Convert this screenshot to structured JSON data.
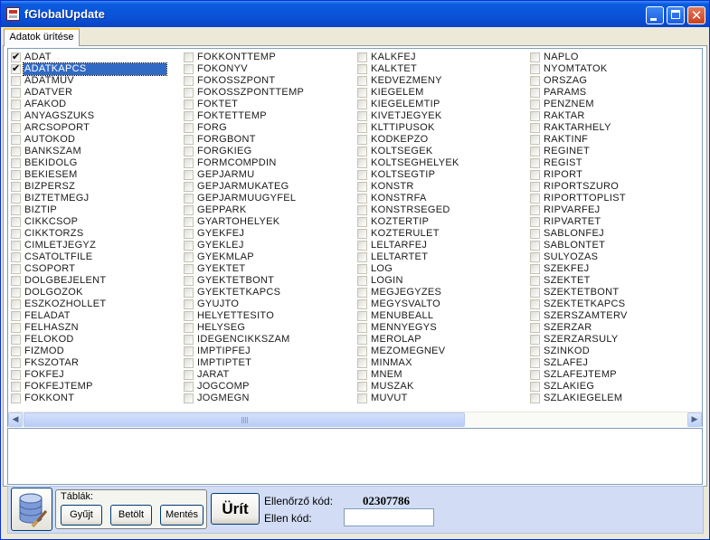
{
  "window": {
    "title": "fGlobalUpdate"
  },
  "tabs": [
    {
      "label": "Adatok ürítése"
    }
  ],
  "columns": [
    [
      {
        "label": "ADAT",
        "checked": true,
        "selected": false
      },
      {
        "label": "ADATKAPCS",
        "checked": true,
        "selected": true
      },
      {
        "label": "ADATMUV",
        "checked": false,
        "selected": false
      },
      {
        "label": "ADATVER",
        "checked": false,
        "selected": false
      },
      {
        "label": "AFAKOD",
        "checked": false,
        "selected": false
      },
      {
        "label": "ANYAGSZUKS",
        "checked": false,
        "selected": false
      },
      {
        "label": "ARCSOPORT",
        "checked": false,
        "selected": false
      },
      {
        "label": "AUTOKOD",
        "checked": false,
        "selected": false
      },
      {
        "label": "BANKSZAM",
        "checked": false,
        "selected": false
      },
      {
        "label": "BEKIDOLG",
        "checked": false,
        "selected": false
      },
      {
        "label": "BEKIESEM",
        "checked": false,
        "selected": false
      },
      {
        "label": "BIZPERSZ",
        "checked": false,
        "selected": false
      },
      {
        "label": "BIZTETMEGJ",
        "checked": false,
        "selected": false
      },
      {
        "label": "BIZTIP",
        "checked": false,
        "selected": false
      },
      {
        "label": "CIKKCSOP",
        "checked": false,
        "selected": false
      },
      {
        "label": "CIKKTORZS",
        "checked": false,
        "selected": false
      },
      {
        "label": "CIMLETJEGYZ",
        "checked": false,
        "selected": false
      },
      {
        "label": "CSATOLTFILE",
        "checked": false,
        "selected": false
      },
      {
        "label": "CSOPORT",
        "checked": false,
        "selected": false
      },
      {
        "label": "DOLGBEJELENT",
        "checked": false,
        "selected": false
      },
      {
        "label": "DOLGOZOK",
        "checked": false,
        "selected": false
      },
      {
        "label": "ESZKOZHOLLET",
        "checked": false,
        "selected": false
      },
      {
        "label": "FELADAT",
        "checked": false,
        "selected": false
      },
      {
        "label": "FELHASZN",
        "checked": false,
        "selected": false
      },
      {
        "label": "FELOKOD",
        "checked": false,
        "selected": false
      },
      {
        "label": "FIZMOD",
        "checked": false,
        "selected": false
      },
      {
        "label": "FKSZOTAR",
        "checked": false,
        "selected": false
      },
      {
        "label": "FOKFEJ",
        "checked": false,
        "selected": false
      },
      {
        "label": "FOKFEJTEMP",
        "checked": false,
        "selected": false
      },
      {
        "label": "FOKKONT",
        "checked": false,
        "selected": false
      }
    ],
    [
      {
        "label": "FOKKONTTEMP",
        "checked": false,
        "selected": false
      },
      {
        "label": "FOKONYV",
        "checked": false,
        "selected": false
      },
      {
        "label": "FOKOSSZPONT",
        "checked": false,
        "selected": false
      },
      {
        "label": "FOKOSSZPONTTEMP",
        "checked": false,
        "selected": false
      },
      {
        "label": "FOKTET",
        "checked": false,
        "selected": false
      },
      {
        "label": "FOKTETTEMP",
        "checked": false,
        "selected": false
      },
      {
        "label": "FORG",
        "checked": false,
        "selected": false
      },
      {
        "label": "FORGBONT",
        "checked": false,
        "selected": false
      },
      {
        "label": "FORGKIEG",
        "checked": false,
        "selected": false
      },
      {
        "label": "FORMCOMPDIN",
        "checked": false,
        "selected": false
      },
      {
        "label": "GEPJARMU",
        "checked": false,
        "selected": false
      },
      {
        "label": "GEPJARMUKATEG",
        "checked": false,
        "selected": false
      },
      {
        "label": "GEPJARMUUGYFEL",
        "checked": false,
        "selected": false
      },
      {
        "label": "GEPPARK",
        "checked": false,
        "selected": false
      },
      {
        "label": "GYARTOHELYEK",
        "checked": false,
        "selected": false
      },
      {
        "label": "GYEKFEJ",
        "checked": false,
        "selected": false
      },
      {
        "label": "GYEKLEJ",
        "checked": false,
        "selected": false
      },
      {
        "label": "GYEKMLAP",
        "checked": false,
        "selected": false
      },
      {
        "label": "GYEKTET",
        "checked": false,
        "selected": false
      },
      {
        "label": "GYEKTETBONT",
        "checked": false,
        "selected": false
      },
      {
        "label": "GYEKTETKAPCS",
        "checked": false,
        "selected": false
      },
      {
        "label": "GYUJTO",
        "checked": false,
        "selected": false
      },
      {
        "label": "HELYETTESITO",
        "checked": false,
        "selected": false
      },
      {
        "label": "HELYSEG",
        "checked": false,
        "selected": false
      },
      {
        "label": "IDEGENCIKKSZAM",
        "checked": false,
        "selected": false
      },
      {
        "label": "IMPTIPFEJ",
        "checked": false,
        "selected": false
      },
      {
        "label": "IMPTIPTET",
        "checked": false,
        "selected": false
      },
      {
        "label": "JARAT",
        "checked": false,
        "selected": false
      },
      {
        "label": "JOGCOMP",
        "checked": false,
        "selected": false
      },
      {
        "label": "JOGMEGN",
        "checked": false,
        "selected": false
      }
    ],
    [
      {
        "label": "KALKFEJ",
        "checked": false,
        "selected": false
      },
      {
        "label": "KALKTET",
        "checked": false,
        "selected": false
      },
      {
        "label": "KEDVEZMENY",
        "checked": false,
        "selected": false
      },
      {
        "label": "KIEGELEM",
        "checked": false,
        "selected": false
      },
      {
        "label": "KIEGELEMTIP",
        "checked": false,
        "selected": false
      },
      {
        "label": "KIVETJEGYEK",
        "checked": false,
        "selected": false
      },
      {
        "label": "KLTTIPUSOK",
        "checked": false,
        "selected": false
      },
      {
        "label": "KODKEPZO",
        "checked": false,
        "selected": false
      },
      {
        "label": "KOLTSEGEK",
        "checked": false,
        "selected": false
      },
      {
        "label": "KOLTSEGHELYEK",
        "checked": false,
        "selected": false
      },
      {
        "label": "KOLTSEGTIP",
        "checked": false,
        "selected": false
      },
      {
        "label": "KONSTR",
        "checked": false,
        "selected": false
      },
      {
        "label": "KONSTRFA",
        "checked": false,
        "selected": false
      },
      {
        "label": "KONSTRSEGED",
        "checked": false,
        "selected": false
      },
      {
        "label": "KOZTERTIP",
        "checked": false,
        "selected": false
      },
      {
        "label": "KOZTERULET",
        "checked": false,
        "selected": false
      },
      {
        "label": "LELTARFEJ",
        "checked": false,
        "selected": false
      },
      {
        "label": "LELTARTET",
        "checked": false,
        "selected": false
      },
      {
        "label": "LOG",
        "checked": false,
        "selected": false
      },
      {
        "label": "LOGIN",
        "checked": false,
        "selected": false
      },
      {
        "label": "MEGJEGYZES",
        "checked": false,
        "selected": false
      },
      {
        "label": "MEGYSVALTO",
        "checked": false,
        "selected": false
      },
      {
        "label": "MENUBEALL",
        "checked": false,
        "selected": false
      },
      {
        "label": "MENNYEGYS",
        "checked": false,
        "selected": false
      },
      {
        "label": "MEROLAP",
        "checked": false,
        "selected": false
      },
      {
        "label": "MEZOMEGNEV",
        "checked": false,
        "selected": false
      },
      {
        "label": "MINMAX",
        "checked": false,
        "selected": false
      },
      {
        "label": "MNEM",
        "checked": false,
        "selected": false
      },
      {
        "label": "MUSZAK",
        "checked": false,
        "selected": false
      },
      {
        "label": "MUVUT",
        "checked": false,
        "selected": false
      }
    ],
    [
      {
        "label": "NAPLO",
        "checked": false,
        "selected": false
      },
      {
        "label": "NYOMTATOK",
        "checked": false,
        "selected": false
      },
      {
        "label": "ORSZAG",
        "checked": false,
        "selected": false
      },
      {
        "label": "PARAMS",
        "checked": false,
        "selected": false
      },
      {
        "label": "PENZNEM",
        "checked": false,
        "selected": false
      },
      {
        "label": "RAKTAR",
        "checked": false,
        "selected": false
      },
      {
        "label": "RAKTARHELY",
        "checked": false,
        "selected": false
      },
      {
        "label": "RAKTINF",
        "checked": false,
        "selected": false
      },
      {
        "label": "REGINET",
        "checked": false,
        "selected": false
      },
      {
        "label": "REGIST",
        "checked": false,
        "selected": false
      },
      {
        "label": "RIPORT",
        "checked": false,
        "selected": false
      },
      {
        "label": "RIPORTSZURO",
        "checked": false,
        "selected": false
      },
      {
        "label": "RIPORTTOPLIST",
        "checked": false,
        "selected": false
      },
      {
        "label": "RIPVARFEJ",
        "checked": false,
        "selected": false
      },
      {
        "label": "RIPVARTET",
        "checked": false,
        "selected": false
      },
      {
        "label": "SABLONFEJ",
        "checked": false,
        "selected": false
      },
      {
        "label": "SABLONTET",
        "checked": false,
        "selected": false
      },
      {
        "label": "SULYOZAS",
        "checked": false,
        "selected": false
      },
      {
        "label": "SZEKFEJ",
        "checked": false,
        "selected": false
      },
      {
        "label": "SZEKTET",
        "checked": false,
        "selected": false
      },
      {
        "label": "SZEKTETBONT",
        "checked": false,
        "selected": false
      },
      {
        "label": "SZEKTETKAPCS",
        "checked": false,
        "selected": false
      },
      {
        "label": "SZERSZAMTERV",
        "checked": false,
        "selected": false
      },
      {
        "label": "SZERZAR",
        "checked": false,
        "selected": false
      },
      {
        "label": "SZERZARSULY",
        "checked": false,
        "selected": false
      },
      {
        "label": "SZINKOD",
        "checked": false,
        "selected": false
      },
      {
        "label": "SZLAFEJ",
        "checked": false,
        "selected": false
      },
      {
        "label": "SZLAFEJTEMP",
        "checked": false,
        "selected": false
      },
      {
        "label": "SZLAKIEG",
        "checked": false,
        "selected": false
      },
      {
        "label": "SZLAKIEGELEM",
        "checked": false,
        "selected": false
      }
    ]
  ],
  "bottom": {
    "group_title": "Táblák:",
    "gyujt_label": "Gyűjt",
    "betolt_label": "Betölt",
    "mentes_label": "Mentés",
    "urit_label": "Ürít",
    "ellenorzo_label": "Ellenőrző kód:",
    "ellenorzo_value": "02307786",
    "ellen_label": "Ellen kód:",
    "ellen_value": ""
  },
  "icons": {
    "title": "app-form-icon",
    "db": "database-icon"
  }
}
